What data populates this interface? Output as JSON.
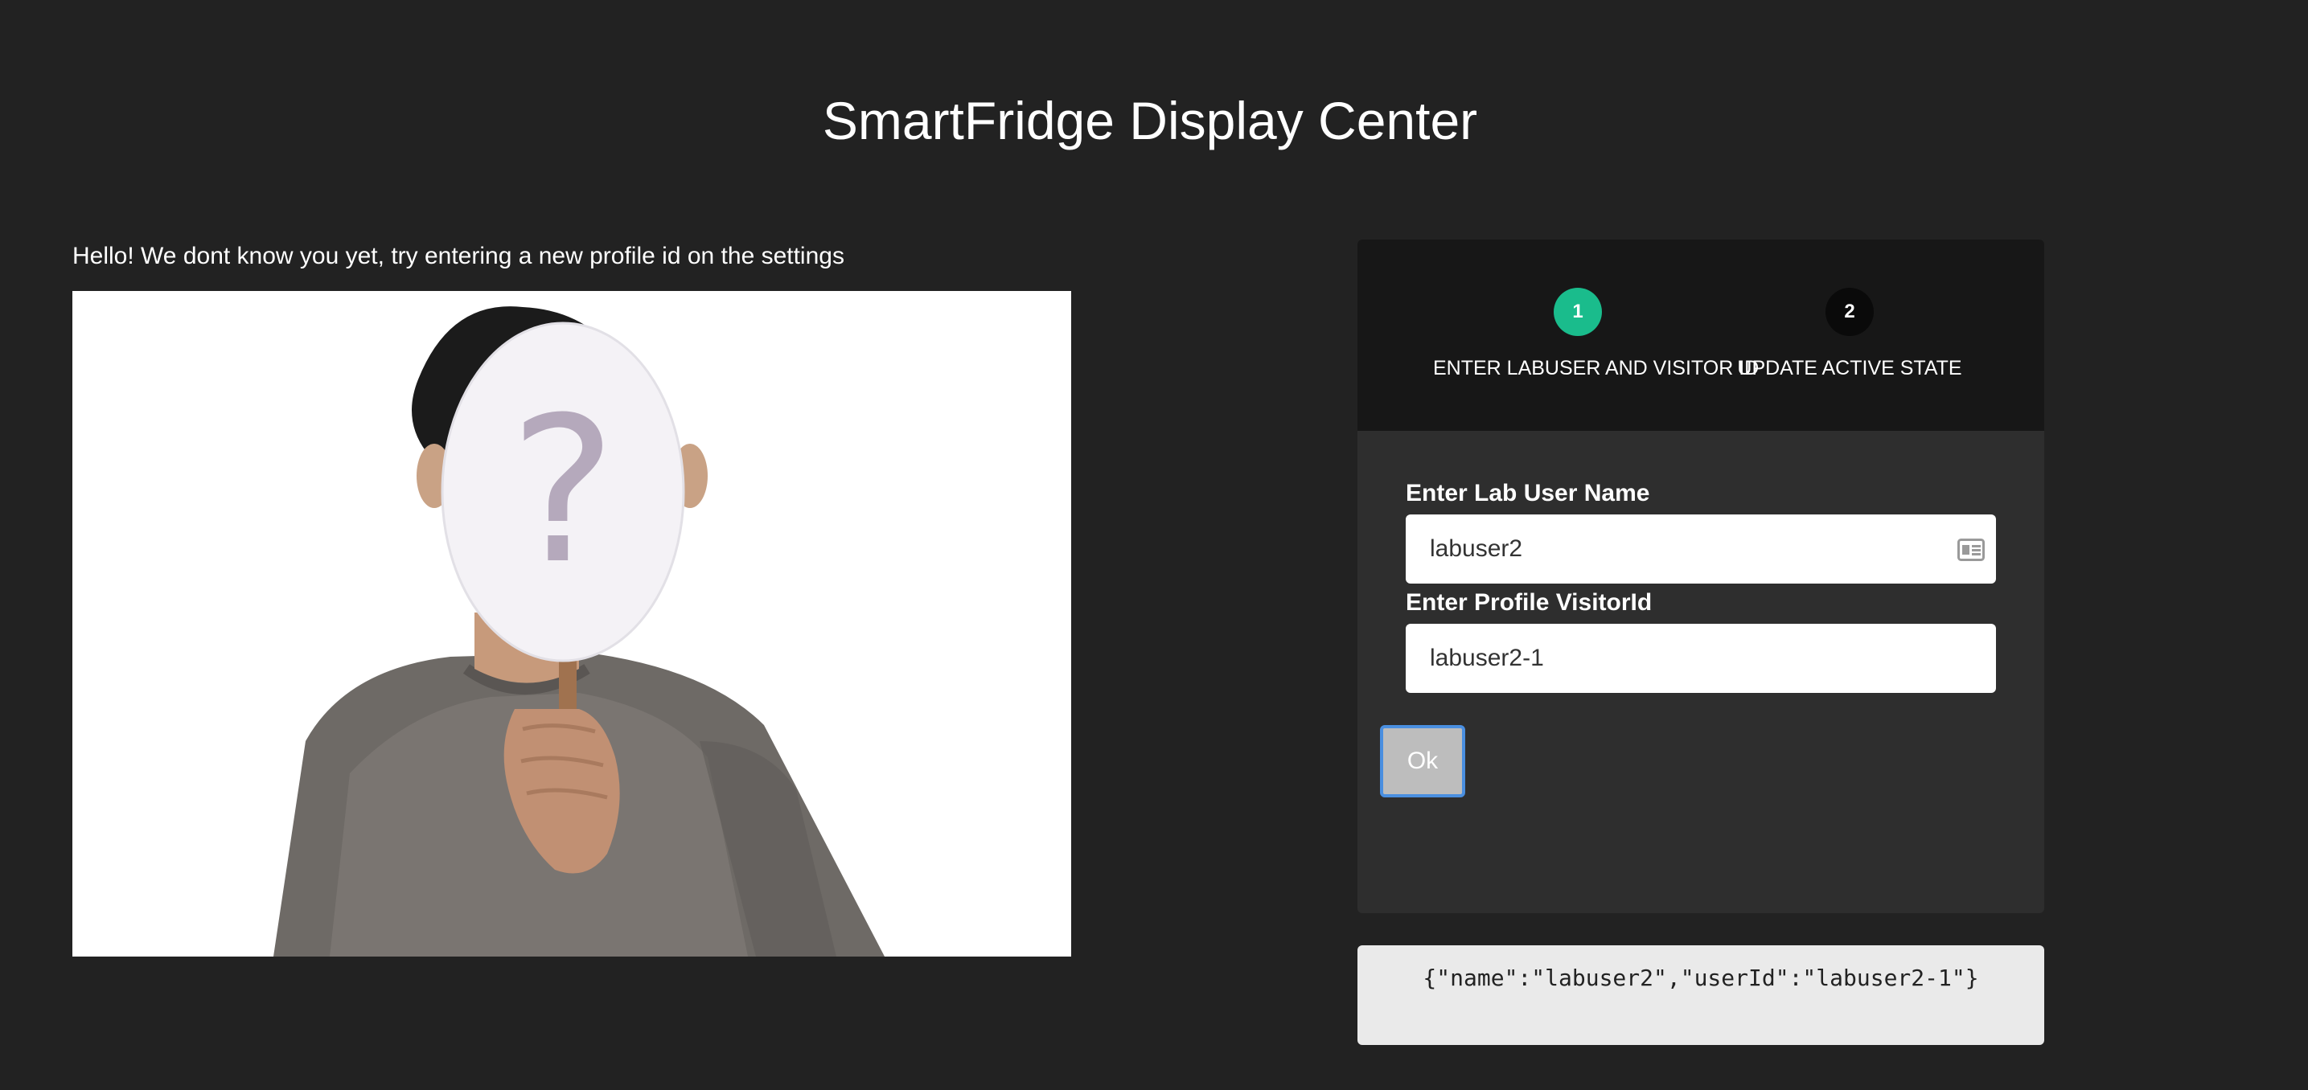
{
  "page": {
    "title": "SmartFridge Display Center"
  },
  "profile": {
    "greeting": "Hello! We dont know you yet, try entering a new profile id on the settings"
  },
  "wizard": {
    "steps": [
      {
        "number": "1",
        "label": "ENTER LABUSER AND VISITOR ID",
        "state": "active"
      },
      {
        "number": "2",
        "label": "UPDATE ACTIVE STATE",
        "state": "inactive"
      }
    ],
    "form": {
      "username_label": "Enter Lab User Name",
      "username_value": "labuser2",
      "visitor_label": "Enter Profile VisitorId",
      "visitor_value": "labuser2-1",
      "ok_label": "Ok"
    }
  },
  "output": {
    "json_text": "{\"name\":\"labuser2\",\"userId\":\"labuser2-1\"}"
  },
  "colors": {
    "background": "#222222",
    "active_step": "#1abc8c",
    "inactive_step": "#0a0a0a",
    "button_focus": "#4a8fe0"
  },
  "icons": {
    "username_field_icon": "id-card-icon"
  }
}
